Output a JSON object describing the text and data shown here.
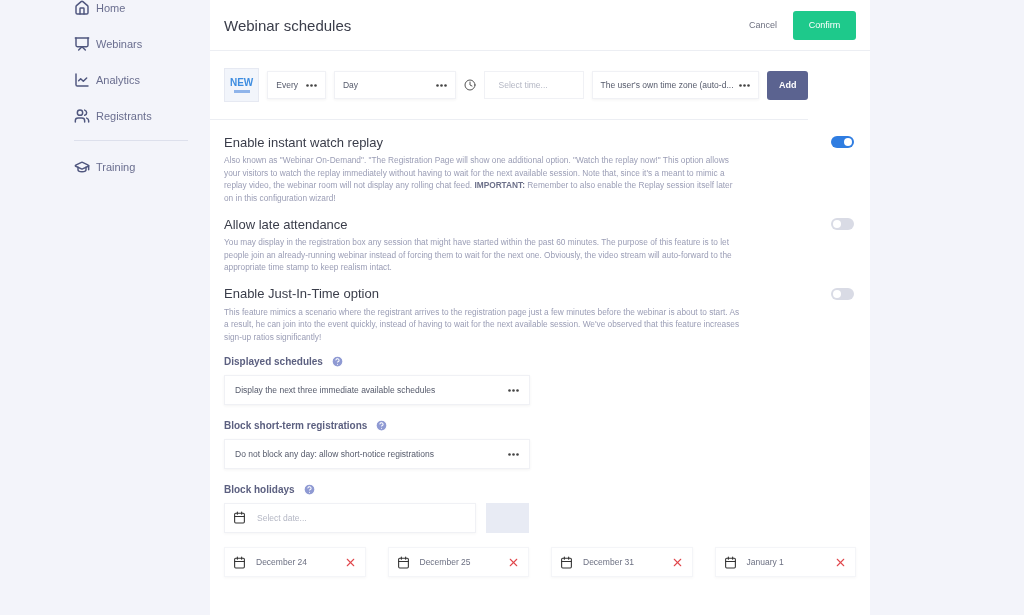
{
  "sidebar": {
    "items": [
      {
        "kind": "home",
        "label": "Home"
      },
      {
        "kind": "webinars",
        "label": "Webinars"
      },
      {
        "kind": "analytics",
        "label": "Analytics"
      },
      {
        "kind": "registrants",
        "label": "Registrants"
      },
      {
        "kind": "training",
        "label": "Training"
      }
    ]
  },
  "header": {
    "title": "Webinar schedules",
    "cancel": "Cancel",
    "confirm": "Confirm"
  },
  "schedule_row": {
    "badge": "NEW",
    "every": "Every",
    "day": "Day",
    "time_placeholder": "Select time...",
    "timezone": "The user's own time zone (auto-d...",
    "add": "Add"
  },
  "options": [
    {
      "title": "Enable instant watch replay",
      "on": true,
      "description": "Also known as \"Webinar On-Demand\". \"The Registration Page will show one additional option. \"Watch the replay now!\" This option allows your visitors to watch the replay immediately without having to wait for the next available session. Note that, since it's a meant to mimic a replay video, the webinar room will not display any rolling chat feed. **IMPORTANT:** Remember to also enable the Replay session itself later on in this configuration wizard!"
    },
    {
      "title": "Allow late attendance",
      "on": false,
      "description": "You may display in the registration box any session that might have started within the past 60 minutes. The purpose of this feature is to let people join an already-running webinar instead of forcing them to wait for the next one. Obviously, the video stream will auto-forward to the appropriate time stamp to keep realism intact."
    },
    {
      "title": "Enable Just-In-Time option",
      "on": false,
      "description": "This feature mimics a scenario where the registrant arrives to the registration page just a few minutes before the webinar is about to start. As a result, he can join into the event quickly, instead of having to wait for the next available session. We've observed that this feature increases sign-up ratios significantly!"
    }
  ],
  "selects": [
    {
      "label": "Displayed schedules",
      "value": "Display the next three immediate available schedules"
    },
    {
      "label": "Block short-term registrations",
      "value": "Do not block any day: allow short-notice registrations"
    }
  ],
  "holidays": {
    "label": "Block holidays",
    "placeholder": "Select date...",
    "add_disabled": true,
    "dates": [
      "December 24",
      "December 25",
      "December 31",
      "January 1"
    ]
  }
}
